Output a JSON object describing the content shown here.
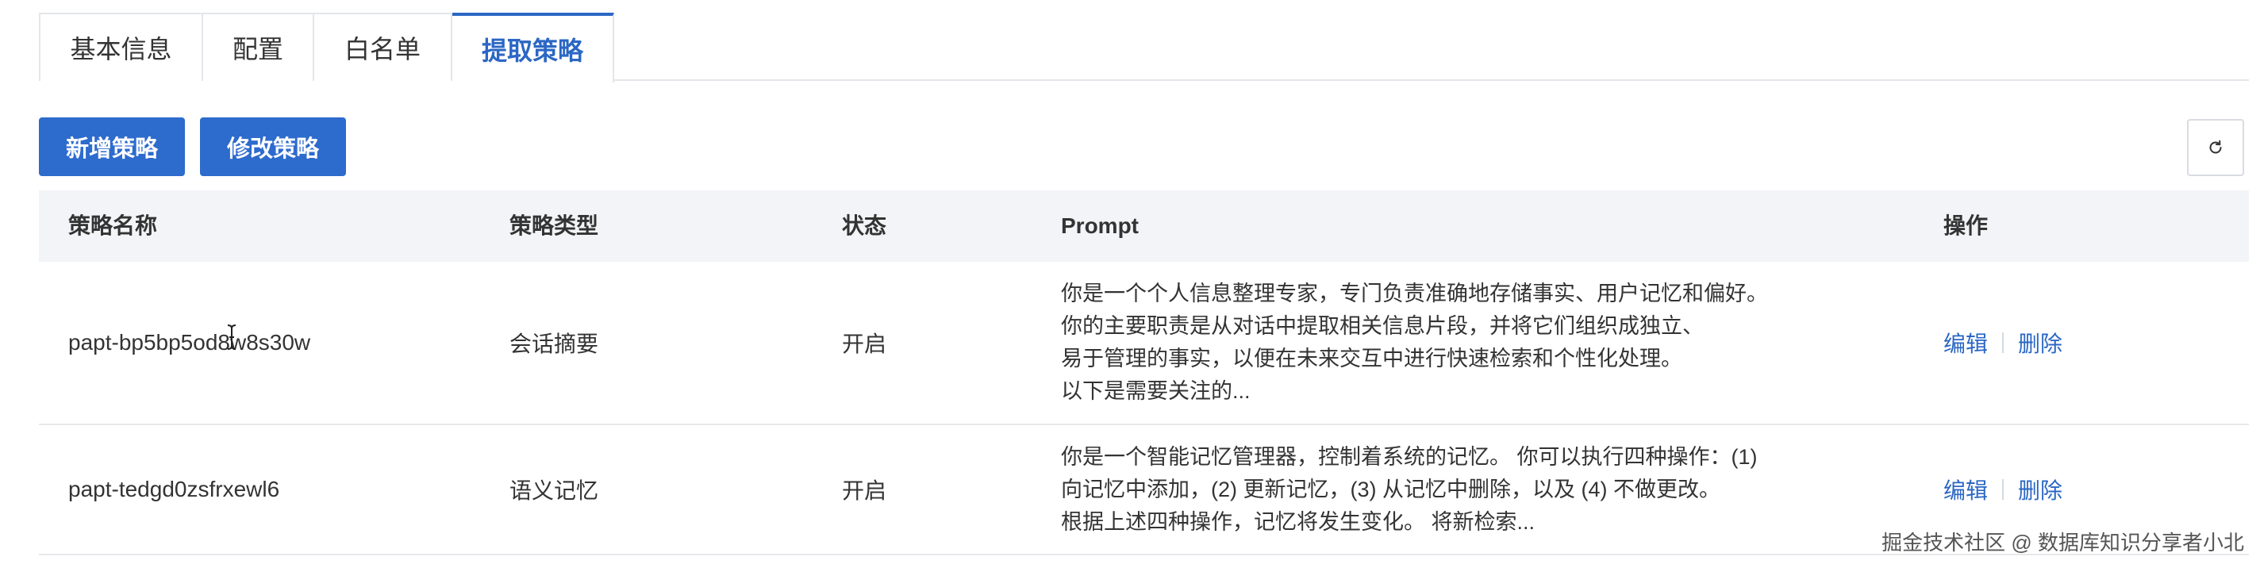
{
  "tabs": [
    {
      "label": "基本信息",
      "active": false
    },
    {
      "label": "配置",
      "active": false
    },
    {
      "label": "白名单",
      "active": false
    },
    {
      "label": "提取策略",
      "active": true
    }
  ],
  "toolbar": {
    "add_label": "新增策略",
    "edit_label": "修改策略",
    "refresh_icon": "refresh-icon"
  },
  "table": {
    "columns": [
      "策略名称",
      "策略类型",
      "状态",
      "Prompt",
      "操作"
    ],
    "rows": [
      {
        "name": "papt-bp5bp5od8w8s30w",
        "type": "会话摘要",
        "status": "开启",
        "prompt_lines": [
          "你是一个个人信息整理专家，专门负责准确地存储事实、用户记忆和偏好。",
          "你的主要职责是从对话中提取相关信息片段，并将它们组织成独立、",
          "易于管理的事实，以便在未来交互中进行快速检索和个性化处理。",
          "以下是需要关注的..."
        ],
        "actions": {
          "edit": "编辑",
          "delete": "删除"
        }
      },
      {
        "name": "papt-tedgd0zsfrxewl6",
        "type": "语义记忆",
        "status": "开启",
        "prompt_lines": [
          "你是一个智能记忆管理器，控制着系统的记忆。 你可以执行四种操作：(1)",
          "向记忆中添加，(2) 更新记忆，(3) 从记忆中删除，以及 (4) 不做更改。",
          "根据上述四种操作，记忆将发生变化。 将新检索..."
        ],
        "actions": {
          "edit": "编辑",
          "delete": "删除"
        }
      }
    ]
  },
  "watermark": "掘金技术社区 @ 数据库知识分享者小北",
  "colors": {
    "accent": "#2b67c4",
    "button_bg": "#2d6bcd",
    "header_bg": "#f2f4f7",
    "border": "#e3e6eb"
  }
}
